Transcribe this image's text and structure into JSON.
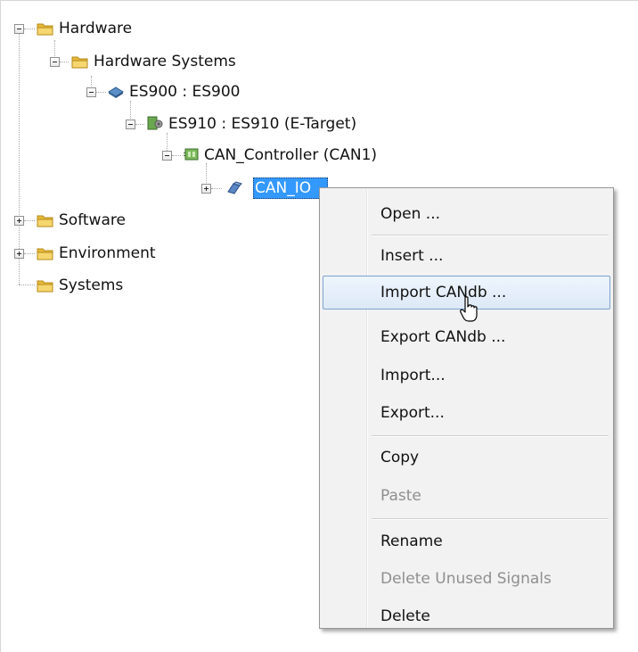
{
  "tree": {
    "nodes": [
      {
        "label": "Hardware",
        "icon": "folder-icon",
        "expander": "collapse"
      },
      {
        "label": "Hardware Systems",
        "icon": "folder-icon",
        "expander": "collapse"
      },
      {
        "label": "ES900 : ES900",
        "icon": "hardware-device-icon",
        "expander": "collapse"
      },
      {
        "label": "ES910 : ES910 (E-Target)",
        "icon": "module-board-icon",
        "expander": "collapse"
      },
      {
        "label": "CAN_Controller (CAN1)",
        "icon": "can-controller-icon",
        "expander": "collapse"
      },
      {
        "label": "CAN_IO",
        "icon": "can-io-icon",
        "expander": "expand",
        "selected": true
      },
      {
        "label": "Software",
        "icon": "folder-icon",
        "expander": "expand"
      },
      {
        "label": "Environment",
        "icon": "folder-icon",
        "expander": "expand"
      },
      {
        "label": "Systems",
        "icon": "folder-icon",
        "expander": "none"
      }
    ]
  },
  "context_menu": {
    "items": [
      {
        "label": "Open ...",
        "enabled": true
      },
      {
        "label": "Insert ...",
        "enabled": true
      },
      {
        "label": "Import CANdb ...",
        "enabled": true,
        "highlighted": true
      },
      {
        "label": "Export CANdb ...",
        "enabled": true
      },
      {
        "label": "Import...",
        "enabled": true
      },
      {
        "label": "Export...",
        "enabled": true
      },
      {
        "label": "Copy",
        "enabled": true
      },
      {
        "label": "Paste",
        "enabled": false
      },
      {
        "label": "Rename",
        "enabled": true
      },
      {
        "label": "Delete Unused Signals",
        "enabled": false
      },
      {
        "label": "Delete",
        "enabled": true
      }
    ]
  },
  "colors": {
    "selection": "#3399ff",
    "menu_highlight_border": "#7da2ce",
    "disabled_text": "#8f8f8f",
    "folder": "#f2c94c"
  }
}
